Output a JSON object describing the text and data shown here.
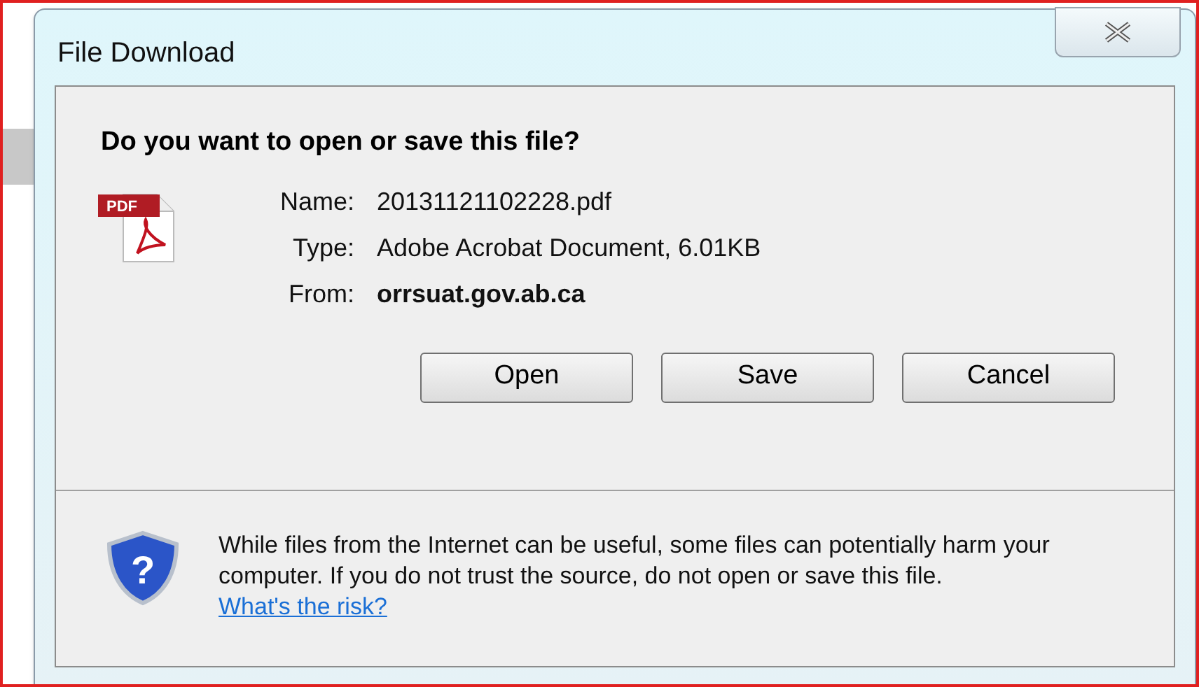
{
  "window": {
    "title": "File Download"
  },
  "file_icon_label": "PDF",
  "shield_glyph": "?",
  "question": "Do you want to open or save this file?",
  "details": [
    {
      "label": "Name:",
      "value": "20131121102228.pdf",
      "bold": false
    },
    {
      "label": "Type:",
      "value": "Adobe Acrobat Document, 6.01KB",
      "bold": false
    },
    {
      "label": "From:",
      "value": "orrsuat.gov.ab.ca",
      "bold": true
    }
  ],
  "buttons": [
    "Open",
    "Save",
    "Cancel"
  ],
  "warning": {
    "text": "While files from the Internet can be useful, some files can potentially harm your computer. If you do not trust the source, do not open or save this file.",
    "link": "What's the risk?"
  }
}
